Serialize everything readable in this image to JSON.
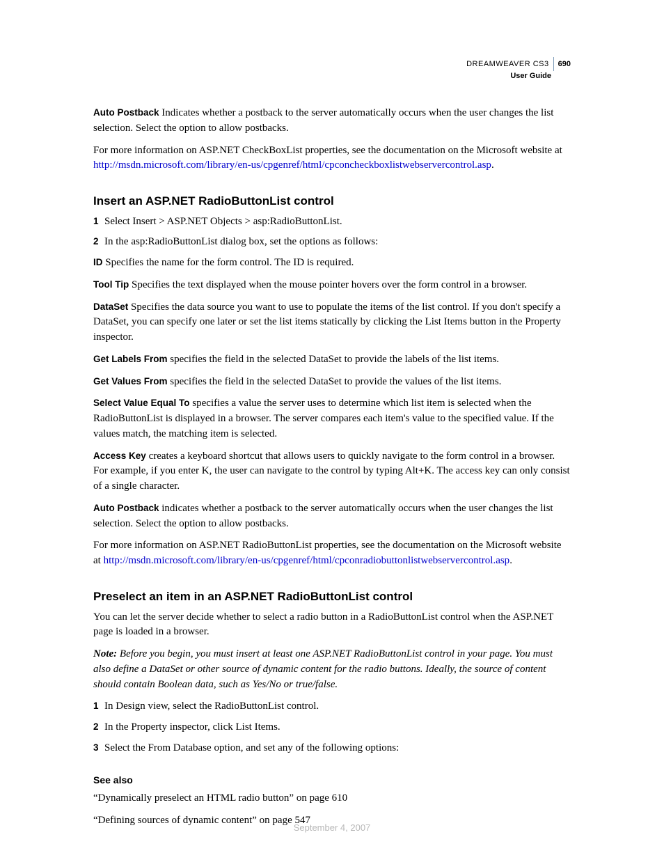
{
  "header": {
    "product": "DREAMWEAVER CS3",
    "page_number": "690",
    "subtitle": "User Guide"
  },
  "intro": {
    "auto_postback_label": "Auto Postback",
    "auto_postback_text": "  Indicates whether a postback to the server automatically occurs when the user changes the list selection. Select the option to allow postbacks.",
    "more_info": "For more information on ASP.NET CheckBoxList properties, see the documentation on the Microsoft website at ",
    "more_info_link": "http://msdn.microsoft.com/library/en-us/cpgenref/html/cpconcheckboxlistwebservercontrol.asp",
    "more_info_tail": "."
  },
  "section1": {
    "heading": "Insert an ASP.NET RadioButtonList control",
    "step1_num": "1",
    "step1": "Select Insert > ASP.NET Objects > asp:RadioButtonList.",
    "step2_num": "2",
    "step2": "In the asp:RadioButtonList dialog box, set the options as follows:",
    "id_label": "ID",
    "id_text": "  Specifies the name for the form control. The ID is required.",
    "tooltip_label": "Tool Tip",
    "tooltip_text": "  Specifies the text displayed when the mouse pointer hovers over the form control in a browser.",
    "dataset_label": "DataSet",
    "dataset_text": "  Specifies the data source you want to use to populate the items of the list control. If you don't specify a DataSet, you can specify one later or set the list items statically by clicking the List Items button in the Property inspector.",
    "getlabels_label": "Get Labels From",
    "getlabels_text": "  specifies the field in the selected DataSet to provide the labels of the list items.",
    "getvalues_label": "Get Values From",
    "getvalues_text": "  specifies the field in the selected DataSet to provide the values of the list items.",
    "selectvalue_label": "Select Value Equal To",
    "selectvalue_text": "  specifies a value the server uses to determine which list item is selected when the RadioButtonList is displayed in a browser. The server compares each item's value to the specified value. If the values match, the matching item is selected.",
    "accesskey_label": "Access Key",
    "accesskey_text": "  creates a keyboard shortcut that allows users to quickly navigate to the form control in a browser. For example, if you enter K, the user can navigate to the control by typing Alt+K. The access key can only consist of a single character.",
    "autopostback_label": "Auto Postback",
    "autopostback_text": "  indicates whether a postback to the server automatically occurs when the user changes the list selection. Select the option to allow postbacks.",
    "more_info": "For more information on ASP.NET RadioButtonList properties, see the documentation on the Microsoft website at ",
    "more_info_link": "http://msdn.microsoft.com/library/en-us/cpgenref/html/cpconradiobuttonlistwebservercontrol.asp",
    "more_info_tail": "."
  },
  "section2": {
    "heading": "Preselect an item in an ASP.NET RadioButtonList control",
    "intro": "You can let the server decide whether to select a radio button in a RadioButtonList control when the ASP.NET page is loaded in a browser.",
    "note_label": "Note:",
    "note_text": " Before you begin, you must insert at least one ASP.NET RadioButtonList control in your page. You must also define a DataSet or other source of dynamic content for the radio buttons. Ideally, the source of content should contain Boolean data, such as Yes/No or true/false.",
    "step1_num": "1",
    "step1": "In Design view, select the RadioButtonList control.",
    "step2_num": "2",
    "step2": "In the Property inspector, click List Items.",
    "step3_num": "3",
    "step3": "Select the From Database option, and set any of the following options:"
  },
  "seealso": {
    "heading": "See also",
    "ref1": "“Dynamically preselect an HTML radio button” on page 610",
    "ref2": "“Defining sources of dynamic content” on page 547"
  },
  "footer": {
    "date": "September 4, 2007"
  }
}
